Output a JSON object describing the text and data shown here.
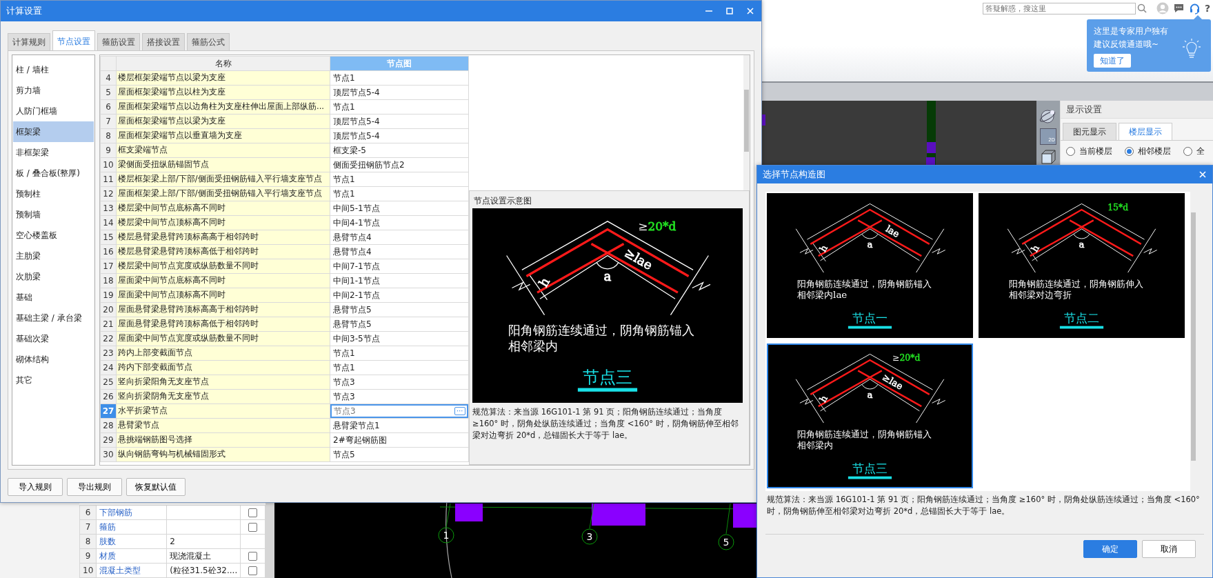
{
  "app": {
    "search": {
      "placeholder": "答疑解惑，搜这里"
    },
    "help_glyph": "?",
    "tip": {
      "lines": [
        "这里是专家用户独有",
        "建议反馈通道哦~"
      ],
      "button": "知道了"
    },
    "view_tools": {
      "label_2d": "2D"
    },
    "display_settings": {
      "title": "显示设置",
      "tabs": [
        {
          "label": "图元显示",
          "selected": false
        },
        {
          "label": "楼层显示",
          "selected": true
        }
      ],
      "options": [
        {
          "label": "当前楼层",
          "selected": false
        },
        {
          "label": "相邻楼层",
          "selected": true
        },
        {
          "label": "全",
          "selected": false
        }
      ]
    },
    "properties": {
      "rows": [
        {
          "index": "6",
          "name": "下部钢筋",
          "kind": "check",
          "checked": false
        },
        {
          "index": "7",
          "name": "箍筋",
          "kind": "check",
          "checked": false
        },
        {
          "index": "8",
          "name": "肢数",
          "value": "2",
          "kind": "plain"
        },
        {
          "index": "9",
          "name": "材质",
          "value": "现浇混凝土",
          "kind": "check",
          "checked": false
        },
        {
          "index": "10",
          "name": "混凝土类型",
          "value": "(粒径31.5砼32....",
          "kind": "check",
          "checked": false
        }
      ]
    },
    "canvas": {
      "axis_labels": [
        "1",
        "3",
        "5"
      ]
    }
  },
  "calc_dialog": {
    "title": "计算设置",
    "tabs": [
      {
        "label": "计算规则",
        "selected": false
      },
      {
        "label": "节点设置",
        "selected": true
      },
      {
        "label": "箍筋设置",
        "selected": false
      },
      {
        "label": "搭接设置",
        "selected": false
      },
      {
        "label": "箍筋公式",
        "selected": false
      }
    ],
    "categories": [
      {
        "label": "柱 / 墙柱",
        "selected": false
      },
      {
        "label": "剪力墙",
        "selected": false
      },
      {
        "label": "人防门框墙",
        "selected": false
      },
      {
        "label": "框架梁",
        "selected": true
      },
      {
        "label": "非框架梁",
        "selected": false
      },
      {
        "label": "板 / 叠合板(整厚)",
        "selected": false
      },
      {
        "label": "预制柱",
        "selected": false
      },
      {
        "label": "预制墙",
        "selected": false
      },
      {
        "label": "空心楼盖板",
        "selected": false
      },
      {
        "label": "主肋梁",
        "selected": false
      },
      {
        "label": "次肋梁",
        "selected": false
      },
      {
        "label": "基础",
        "selected": false
      },
      {
        "label": "基础主梁 / 承台梁",
        "selected": false
      },
      {
        "label": "基础次梁",
        "selected": false
      },
      {
        "label": "砌体结构",
        "selected": false
      },
      {
        "label": "其它",
        "selected": false
      }
    ],
    "table": {
      "columns": [
        {
          "label": "名称",
          "selected": false
        },
        {
          "label": "节点图",
          "selected": true
        }
      ],
      "browse_button": "⋯",
      "rows": [
        {
          "index": "4",
          "name": "楼层框架梁端节点以梁为支座",
          "node": "节点1",
          "selected": false
        },
        {
          "index": "5",
          "name": "屋面框架梁端节点以柱为支座",
          "node": "顶层节点5-4",
          "selected": false
        },
        {
          "index": "6",
          "name": "屋面框架梁端节点以边角柱为支座柱伸出屋面上部纵筋...",
          "node": "节点1",
          "selected": false
        },
        {
          "index": "7",
          "name": "屋面框架梁端节点以梁为支座",
          "node": "顶层节点5-4",
          "selected": false
        },
        {
          "index": "8",
          "name": "屋面框架梁端节点以垂直墙为支座",
          "node": "顶层节点5-4",
          "selected": false
        },
        {
          "index": "9",
          "name": "框支梁端节点",
          "node": "框支梁-5",
          "selected": false
        },
        {
          "index": "10",
          "name": "梁侧面受扭纵筋锚固节点",
          "node": "侧面受扭钢筋节点2",
          "selected": false
        },
        {
          "index": "11",
          "name": "楼层框架梁上部/下部/侧面受扭钢筋锚入平行墙支座节点",
          "node": "节点1",
          "selected": false
        },
        {
          "index": "12",
          "name": "屋面框架梁上部/下部/侧面受扭钢筋锚入平行墙支座节点",
          "node": "节点1",
          "selected": false
        },
        {
          "index": "13",
          "name": "楼层梁中间节点底标高不同时",
          "node": "中间5-1节点",
          "selected": false
        },
        {
          "index": "14",
          "name": "楼层梁中间节点顶标高不同时",
          "node": "中间4-1节点",
          "selected": false
        },
        {
          "index": "15",
          "name": "楼层悬臂梁悬臂跨顶标高高于相邻跨时",
          "node": "悬臂节点4",
          "selected": false
        },
        {
          "index": "16",
          "name": "楼层悬臂梁悬臂跨顶标高低于相邻跨时",
          "node": "悬臂节点4",
          "selected": false
        },
        {
          "index": "17",
          "name": "楼层梁中间节点宽度或纵筋数量不同时",
          "node": "中间7-1节点",
          "selected": false
        },
        {
          "index": "18",
          "name": "屋面梁中间节点底标高不同时",
          "node": "中间1-1节点",
          "selected": false
        },
        {
          "index": "19",
          "name": "屋面梁中间节点顶标高不同时",
          "node": "中间2-1节点",
          "selected": false
        },
        {
          "index": "20",
          "name": "屋面悬臂梁悬臂跨顶标高高于相邻跨时",
          "node": "悬臂节点5",
          "selected": false
        },
        {
          "index": "21",
          "name": "屋面悬臂梁悬臂跨顶标高低于相邻跨时",
          "node": "悬臂节点5",
          "selected": false
        },
        {
          "index": "22",
          "name": "屋面梁中间节点宽度或纵筋数量不同时",
          "node": "中间3-5节点",
          "selected": false
        },
        {
          "index": "23",
          "name": "跨内上部变截面节点",
          "node": "节点1",
          "selected": false
        },
        {
          "index": "24",
          "name": "跨内下部变截面节点",
          "node": "节点1",
          "selected": false
        },
        {
          "index": "25",
          "name": "竖向折梁阳角无支座节点",
          "node": "节点3",
          "selected": false
        },
        {
          "index": "26",
          "name": "竖向折梁阴角无支座节点",
          "node": "节点3",
          "selected": false
        },
        {
          "index": "27",
          "name": "水平折梁节点",
          "node": "节点3",
          "selected": true
        },
        {
          "index": "28",
          "name": "悬臂梁节点",
          "node": "悬臂梁节点1",
          "selected": false
        },
        {
          "index": "29",
          "name": "悬挑端钢筋图号选择",
          "node": "2#弯起钢筋图",
          "selected": false
        },
        {
          "index": "30",
          "name": "纵向钢筋弯钩与机械锚固形式",
          "node": "节点5",
          "selected": false
        }
      ]
    },
    "preview": {
      "title": "节点设置示意图",
      "diagram": {
        "label": "节点三",
        "caption": [
          "阳角钢筋连续通过，阴角钢筋锚入",
          "相邻梁内"
        ],
        "labels": [
          {
            "kind": "bend",
            "prefix": "≥",
            "text": "20*d",
            "color": "#22dd22"
          },
          {
            "kind": "anchor",
            "text": "≥lae",
            "color": "#ffffff"
          },
          {
            "kind": "angle",
            "text": "a",
            "color": "#ffffff"
          },
          {
            "kind": "height",
            "text": "h",
            "color": "#ffffff"
          }
        ]
      },
      "description": "规范算法：来当源 16G101-1 第 91 页；阳角钢筋连续通过；当角度 ≥160° 时，阴角处纵筋连续通过；当角度 <160° 时，阴角钢筋伸至相邻梁对边弯折 20*d，总锚固长大于等于 lae。"
    },
    "buttons": [
      "导入规则",
      "导出规则",
      "恢复默认值"
    ]
  },
  "node_picker": {
    "title": "选择节点构造图",
    "options": [
      {
        "label": "节点一",
        "caption": [
          "阳角钢筋连续通过，阴角钢筋锚入",
          "相邻梁内lae"
        ],
        "selected": false,
        "labels": [
          {
            "kind": "anchor",
            "text": "lae",
            "color": "#ffffff"
          },
          {
            "kind": "angle",
            "text": "a",
            "color": "#ffffff"
          },
          {
            "kind": "height",
            "text": "h",
            "color": "#ffffff"
          }
        ]
      },
      {
        "label": "节点二",
        "caption": [
          "阳角钢筋连续通过，阴角钢筋伸入",
          "相邻梁对边弯折"
        ],
        "selected": false,
        "labels": [
          {
            "kind": "bend",
            "text": "15*d",
            "color": "#22dd22"
          },
          {
            "kind": "angle",
            "text": "a",
            "color": "#ffffff"
          },
          {
            "kind": "height",
            "text": "h",
            "color": "#ffffff"
          }
        ]
      },
      {
        "label": "节点三",
        "caption": [
          "阳角钢筋连续通过，阴角钢筋锚入",
          "相邻梁内"
        ],
        "selected": true,
        "labels": [
          {
            "kind": "bend",
            "prefix": "≥",
            "text": "20*d",
            "color": "#22dd22"
          },
          {
            "kind": "anchor",
            "text": "≥lae",
            "color": "#ffffff"
          },
          {
            "kind": "angle",
            "text": "a",
            "color": "#ffffff"
          },
          {
            "kind": "height",
            "text": "h",
            "color": "#ffffff"
          }
        ]
      }
    ],
    "description": "规范算法：来当源 16G101-1 第 91 页；阳角钢筋连续通过；当角度 ≥160° 时，阴角处纵筋连续通过；当角度 <160° 时，阴角钢筋伸至相邻梁对边弯折 20*d，总锚固长大于等于 lae。",
    "buttons": [
      {
        "label": "确定",
        "primary": true
      },
      {
        "label": "取消",
        "primary": false
      }
    ]
  }
}
